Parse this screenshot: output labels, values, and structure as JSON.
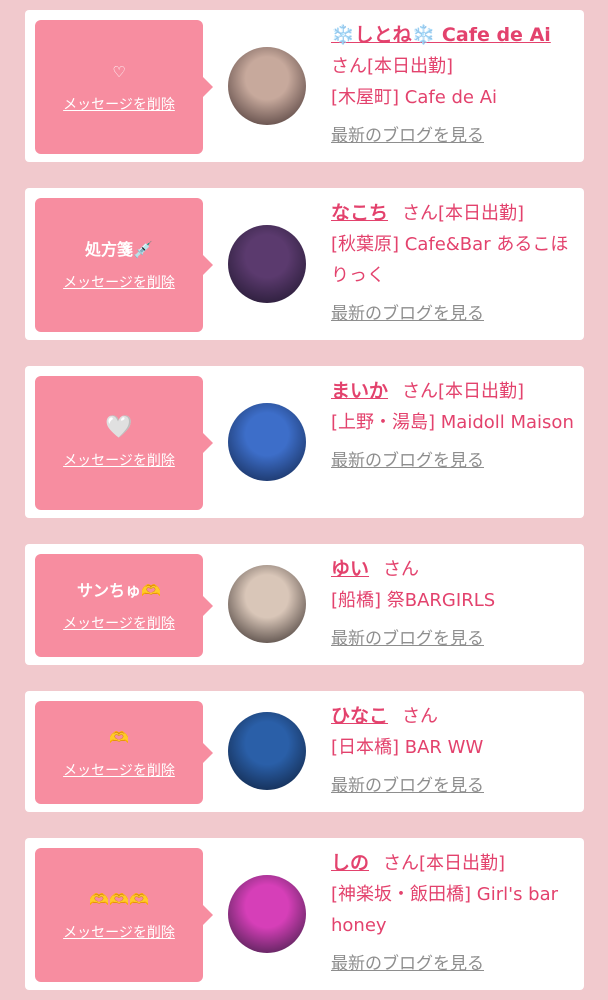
{
  "favorites": [
    {
      "message": "♡",
      "delete_label": "メッセージを削除",
      "name": "❄️しとね❄️ Cafe de Ai",
      "suffix": "さん",
      "status": "[本日出勤]",
      "shop": "[木屋町] Cafe de Ai",
      "blog_label": "最新のブログを見る",
      "avatar_colors": [
        "#c7a99c",
        "#3b2a2a"
      ]
    },
    {
      "message": "処方箋💉",
      "delete_label": "メッセージを削除",
      "name": "なこち",
      "suffix": "さん",
      "status": "[本日出勤]",
      "shop": "[秋葉原] Cafe&Bar あるこほりっく",
      "blog_label": "最新のブログを見る",
      "avatar_colors": [
        "#5b3a6e",
        "#1a1428"
      ]
    },
    {
      "message": "🤍",
      "delete_label": "メッセージを削除",
      "name": "まいか",
      "suffix": "さん",
      "status": "[本日出勤]",
      "shop": "[上野・湯島] Maidoll Maison",
      "blog_label": "最新のブログを見る",
      "avatar_colors": [
        "#3d6ec9",
        "#102246"
      ]
    },
    {
      "message": "サンちゅ🫶",
      "delete_label": "メッセージを削除",
      "name": "ゆい",
      "suffix": "さん",
      "status": "",
      "shop": "[船橋] 祭BARGIRLS",
      "blog_label": "最新のブログを見る",
      "avatar_colors": [
        "#d9c6b8",
        "#2b2220"
      ]
    },
    {
      "message": "🫶",
      "delete_label": "メッセージを削除",
      "name": "ひなこ",
      "suffix": "さん",
      "status": "",
      "shop": "[日本橋] BAR WW",
      "blog_label": "最新のブログを見る",
      "avatar_colors": [
        "#2a5fa8",
        "#0d1c36"
      ]
    },
    {
      "message": "🫶🫶🫶",
      "delete_label": "メッセージを削除",
      "name": "しの",
      "suffix": "さん",
      "status": "[本日出勤]",
      "shop": "[神楽坂・飯田橋] Girl's bar honey",
      "blog_label": "最新のブログを見る",
      "avatar_colors": [
        "#d63fb8",
        "#2f1a3a"
      ]
    }
  ]
}
